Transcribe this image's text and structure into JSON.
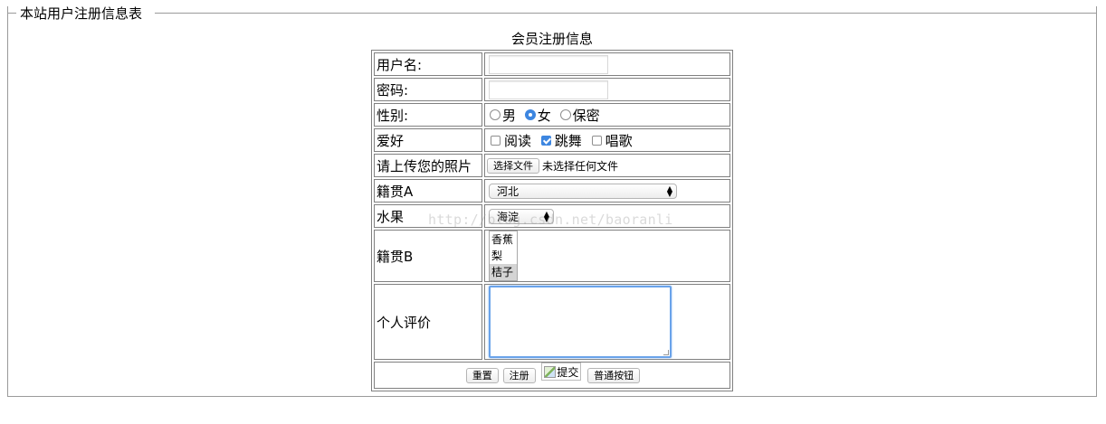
{
  "fieldset": {
    "legend": "本站用户注册信息表"
  },
  "form": {
    "caption": "会员注册信息",
    "username": {
      "label": "用户名:",
      "value": ""
    },
    "password": {
      "label": "密码:",
      "value": ""
    },
    "gender": {
      "label": "性别:",
      "options": [
        "男",
        "女",
        "保密"
      ],
      "selected": "女"
    },
    "hobby": {
      "label": "爱好",
      "options": [
        "阅读",
        "跳舞",
        "唱歌"
      ],
      "checked": [
        "跳舞"
      ]
    },
    "photo": {
      "label": "请上传您的照片",
      "button": "选择文件",
      "status": "未选择任何文件"
    },
    "hometown_a": {
      "label": "籍贯A",
      "selected": "河北"
    },
    "fruit": {
      "label": "水果",
      "selected": "海淀"
    },
    "hometown_b": {
      "label": "籍贯B",
      "options": [
        "香蕉",
        "梨",
        "桔子"
      ],
      "selected": "桔子"
    },
    "comment": {
      "label": "个人评价",
      "value": ""
    },
    "actions": {
      "reset": "重置",
      "register": "注册",
      "image_submit_alt": "提交",
      "plain": "普通按钮"
    }
  },
  "watermark": "http://blog.csdn.net/baoranli",
  "colors": {
    "focus_blue": "#3d86e0",
    "border": "#808080"
  }
}
